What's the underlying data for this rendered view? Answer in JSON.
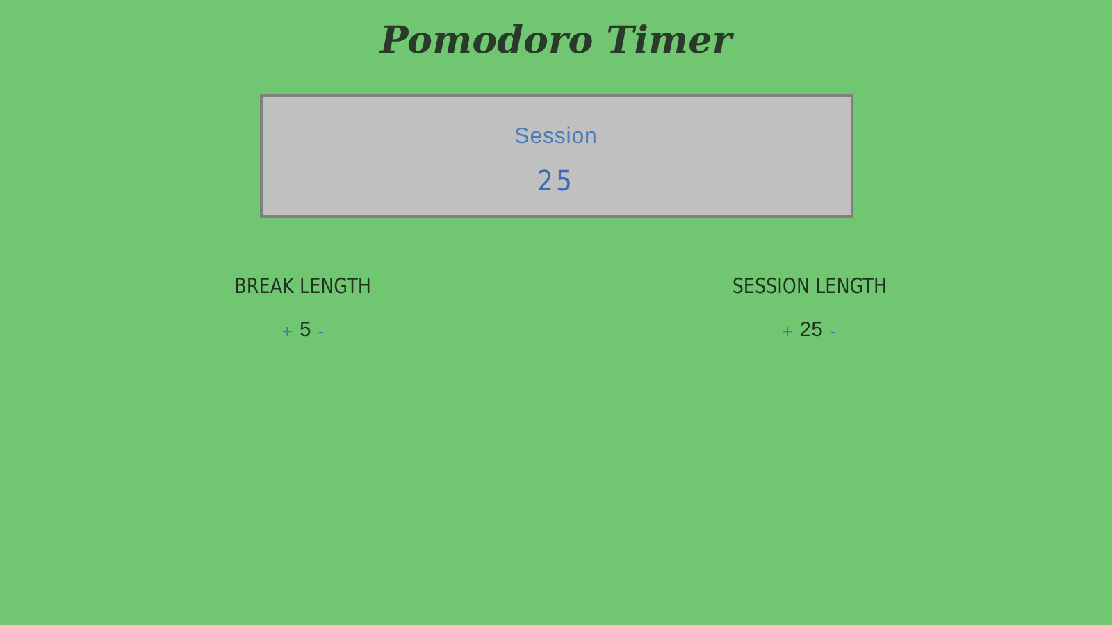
{
  "title": "Pomodoro Timer",
  "timer": {
    "label": "Session",
    "time": "25"
  },
  "settings": [
    {
      "label": "BREAK LENGTH",
      "increment": "+",
      "value": "5",
      "decrement": "-"
    },
    {
      "label": "SESSION LENGTH",
      "increment": "+",
      "value": "25",
      "decrement": "-"
    }
  ]
}
